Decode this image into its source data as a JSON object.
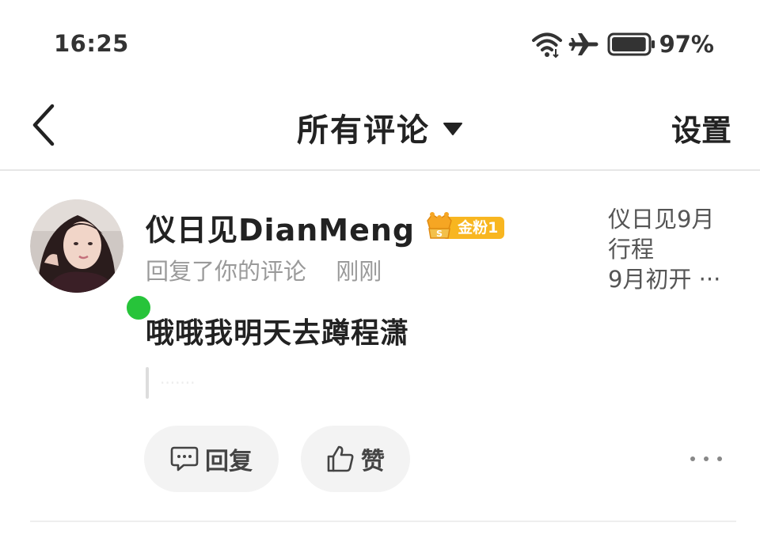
{
  "status_bar": {
    "time": "16:25",
    "battery_percent": "97%",
    "battery_level": 0.97,
    "icons": [
      "wifi-icon",
      "airplane-icon",
      "battery-icon"
    ]
  },
  "nav": {
    "back_icon": "chevron-left-icon",
    "title": "所有评论",
    "dropdown_icon": "triangle-down-icon",
    "settings_label": "设置"
  },
  "comment": {
    "username": "仪日见DianMeng",
    "badge_label": "金粉1",
    "badge_colors": {
      "pill": "#f8b620",
      "crown": "#f6a623"
    },
    "action_text": "回复了你的评论",
    "time": "刚刚",
    "text": "哦哦我明天去蹲程潇",
    "quote_text": "·······",
    "online_status_color": "#27c43a",
    "referenced_post": {
      "line1": "仪日见9月",
      "line2": "行程",
      "line3": "9月初开 ···"
    },
    "actions": {
      "reply_label": "回复",
      "reply_icon": "comment-bubble-icon",
      "like_label": "赞",
      "like_icon": "thumbs-up-icon",
      "more_icon": "more-dots-icon"
    }
  }
}
